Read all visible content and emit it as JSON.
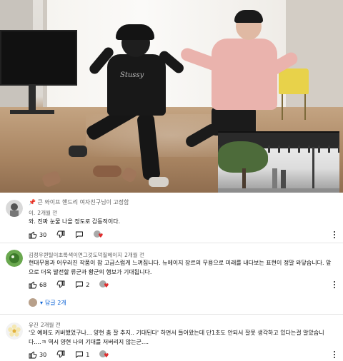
{
  "pinned_comment": {
    "pin_text": "큰 와이프 핸드리 여자친구님이 고정함",
    "author": "이.",
    "time": "2개월 전",
    "text": "와. 진짜 눈물 나올 정도로 감동적이다.",
    "likes": "30"
  },
  "comment_2": {
    "author": "김정우퀸틸이초록색이연그것도덕질헤이지",
    "time": "2개월 전",
    "text": "현대무용과 어우러진 작품이 참 고급스럽게 느껴집니다. 뉴에이지 장르의 무용으로 미래를 내다보는 표현이 정말 와닿습니다. 앞으로 더욱 발전할 류군과 황군의 행보가 기대됩니다.",
    "likes": "68",
    "reply_count": "2",
    "replies_label": "답글 2개"
  },
  "comment_3": {
    "author": "유진",
    "time": "2개월 전",
    "text": "'오 예에도 커버했었구나... 양현 춤 잘 추지.. 기대된다' 하면서 들어왔는데 단1초도 안되서 잘못 생각하고 있다는걸 알았습니다....ㅋ 역시 양현 나의 기대를 저버리지 않는군....",
    "likes": "30",
    "reply_count": "1"
  },
  "icons": {
    "pin": "pin-icon",
    "like": "thumbs-up-icon",
    "dislike": "thumbs-down-icon",
    "reply": "reply-icon",
    "heart": "creator-heart-icon",
    "more": "more-vert-icon",
    "expand": "chevron-down-icon"
  },
  "colors": {
    "link_blue": "#065fd4",
    "heart_red": "#e02c2c",
    "meta_gray": "#606060"
  }
}
